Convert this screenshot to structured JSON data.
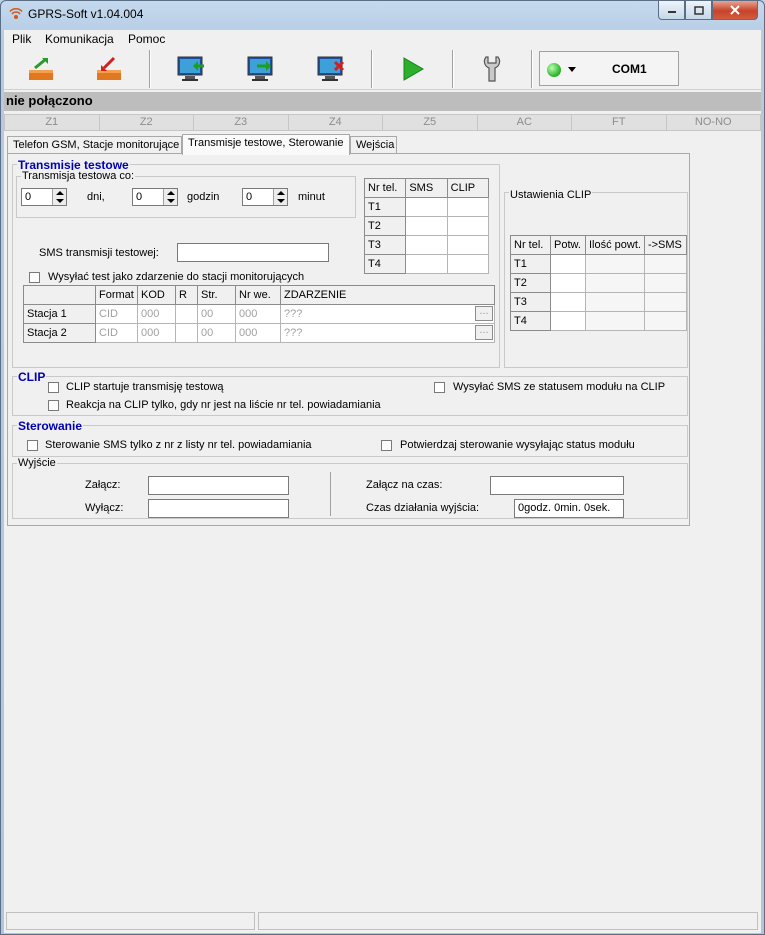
{
  "window": {
    "title": "GPRS-Soft v1.04.004"
  },
  "menu": [
    "Plik",
    "Komunikacja",
    "Pomoc"
  ],
  "toolbar": {
    "buttons": [
      "open-file-icon",
      "save-file-icon",
      "connect-icon",
      "upload-icon",
      "disconnect-icon",
      "play-icon",
      "settings-wrench-icon"
    ],
    "status_color": "#1ec81e",
    "port": "COM1"
  },
  "status": "nie połączono",
  "zones": [
    "Z1",
    "Z2",
    "Z3",
    "Z4",
    "Z5",
    "AC",
    "FT",
    "NO-NO"
  ],
  "tabs": [
    "Telefon GSM, Stacje monitorujące",
    "Transmisje testowe, Sterowanie",
    "Wejścia"
  ],
  "test_transmission": {
    "group_title": "Transmisje testowe",
    "subgroup_title": "Transmisja testowa co:",
    "days_value": "0",
    "days_label": "dni,",
    "hours_value": "0",
    "hours_label": "godzin",
    "minutes_value": "0",
    "minutes_label": "minut",
    "sms_label": "SMS transmisji testowej:",
    "sms_value": "",
    "send_as_event_label": "Wysyłać test jako zdarzenie do stacji monitorujących",
    "phones_table": {
      "headers": [
        "Nr tel.",
        "SMS",
        "CLIP"
      ],
      "rows": [
        "T1",
        "T2",
        "T3",
        "T4"
      ]
    },
    "stations_table": {
      "headers": [
        "",
        "Format",
        "KOD",
        "R",
        "Str.",
        "Nr we.",
        "ZDARZENIE"
      ],
      "rows": [
        {
          "name": "Stacja 1",
          "format": "CID",
          "kod": "000",
          "r": "",
          "str": "00",
          "nrwe": "000",
          "event": "???"
        },
        {
          "name": "Stacja 2",
          "format": "CID",
          "kod": "000",
          "r": "",
          "str": "00",
          "nrwe": "000",
          "event": "???"
        }
      ],
      "button_label": "..."
    }
  },
  "clip_settings": {
    "title": "Ustawienia CLIP",
    "headers": [
      "Nr tel.",
      "Potw.",
      "Ilość powt.",
      "->SMS"
    ],
    "rows": [
      "T1",
      "T2",
      "T3",
      "T4"
    ]
  },
  "clip": {
    "title": "CLIP",
    "starts_test": "CLIP startuje transmisję testową",
    "send_sms_status": "Wysyłać SMS ze statusem modułu na CLIP",
    "react_only": "Reakcja na CLIP tylko, gdy nr jest na liście nr tel. powiadamiania"
  },
  "control": {
    "title": "Sterowanie",
    "sms_only": "Sterowanie SMS tylko z nr z listy nr tel. powiadamiania",
    "confirm": "Potwierdzaj sterowanie wysyłając status modułu",
    "output_title": "Wyjście",
    "on_label": "Załącz:",
    "off_label": "Wyłącz:",
    "on_time_label": "Załącz na czas:",
    "run_time_label": "Czas działania wyjścia:",
    "run_time_value": "0godz. 0min. 0sek."
  }
}
